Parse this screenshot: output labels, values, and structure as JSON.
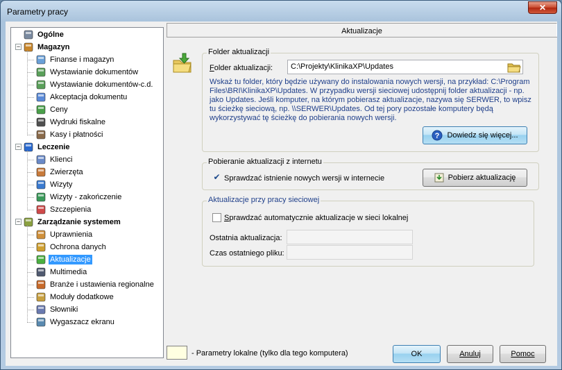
{
  "window": {
    "title": "Parametry pracy",
    "close_label": "✕"
  },
  "tree": {
    "groups": [
      {
        "label": "Ogólne",
        "icon": "computer-icon",
        "children": []
      },
      {
        "label": "Magazyn",
        "icon": "warehouse-worker-icon",
        "children": [
          {
            "label": "Finanse i magazyn",
            "icon": "documents-icon"
          },
          {
            "label": "Wystawianie dokumentów",
            "icon": "document-edit-icon"
          },
          {
            "label": "Wystawianie dokumentów-c.d.",
            "icon": "document-edit-icon"
          },
          {
            "label": "Akceptacja dokumentu",
            "icon": "document-check-icon"
          },
          {
            "label": "Ceny",
            "icon": "money-icon"
          },
          {
            "label": "Wydruki fiskalne",
            "icon": "fiscal-printer-icon"
          },
          {
            "label": "Kasy i płatności",
            "icon": "cash-register-icon"
          }
        ]
      },
      {
        "label": "Leczenie",
        "icon": "medical-book-icon",
        "children": [
          {
            "label": "Klienci",
            "icon": "client-list-icon"
          },
          {
            "label": "Zwierzęta",
            "icon": "animal-icon"
          },
          {
            "label": "Wizyty",
            "icon": "visit-icon"
          },
          {
            "label": "Wizyty - zakończenie",
            "icon": "visit-end-icon"
          },
          {
            "label": "Szczepienia",
            "icon": "syringe-icon"
          }
        ]
      },
      {
        "label": "Zarządzanie systemem",
        "icon": "system-admin-icon",
        "children": [
          {
            "label": "Uprawnienia",
            "icon": "users-permissions-icon"
          },
          {
            "label": "Ochrona danych",
            "icon": "padlock-icon"
          },
          {
            "label": "Aktualizacje",
            "icon": "update-icon"
          },
          {
            "label": "Multimedia",
            "icon": "multimedia-icon"
          },
          {
            "label": "Branże i ustawienia regionalne",
            "icon": "regional-settings-icon"
          },
          {
            "label": "Moduły dodatkowe",
            "icon": "modules-icon"
          },
          {
            "label": "Słowniki",
            "icon": "dictionary-icon"
          },
          {
            "label": "Wygaszacz ekranu",
            "icon": "screensaver-icon"
          }
        ]
      }
    ],
    "selected": "Aktualizacje"
  },
  "panel": {
    "title": "Aktualizacje"
  },
  "folder_group": {
    "title": "Folder aktualizacji",
    "field_label_u": "F",
    "field_label_rest": "older aktualizacji:",
    "field_value": "C:\\Projekty\\KlinikaXP\\Updates",
    "info_lines": [
      "Wskaż tu folder, który będzie używany do instalowania nowych wersji, na przykład: C:\\Program",
      "Files\\BRI\\KlinikaXP\\Updates. W przypadku wersji sieciowej udostępnij folder  aktualizacji - np.",
      "jako Updates. Jeśli komputer, na którym pobierasz aktualizacje, nazywa się SERWER, to wpisz",
      "tu ścieżkę  sieciową, np.  \\\\SERWER\\Updates. Od tej pory pozostałe komputery będą",
      "wykorzystywać tę ścieżkę do pobierania nowych wersji."
    ],
    "learn_more": "Dowiedz się więcej..."
  },
  "internet_group": {
    "title": "Pobieranie aktualizacji z internetu",
    "checkbox_label": "Sprawdzać istnienie nowych wersji w internecie",
    "checked": true,
    "download_btn": "Pobierz aktualizację"
  },
  "network_group": {
    "title": "Aktualizacje przy pracy sieciowej",
    "checkbox_label_u": "S",
    "checkbox_label_rest": "prawdzać automatycznie aktualizacje w sieci lokalnej",
    "checked": false,
    "last_update_label": "Ostatnia aktualizacja:",
    "last_update_value": "",
    "last_file_label": "Czas ostatniego pliku:",
    "last_file_value": ""
  },
  "footer": {
    "legend": "- Parametry lokalne (tylko dla tego komputera)",
    "ok": "OK",
    "cancel": "Anuluj",
    "help": "Pomoc"
  },
  "colors": {
    "selection": "#3399ff",
    "info_text": "#1f3f8a",
    "local_param_swatch": "#ffffe1"
  }
}
